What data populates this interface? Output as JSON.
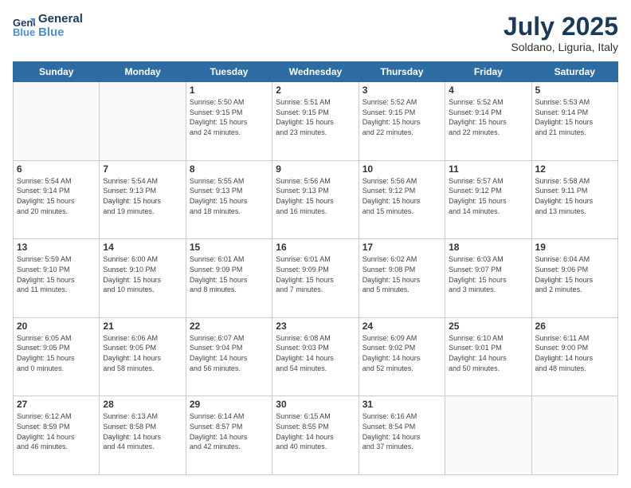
{
  "header": {
    "logo_line1": "General",
    "logo_line2": "Blue",
    "month_title": "July 2025",
    "location": "Soldano, Liguria, Italy"
  },
  "days_of_week": [
    "Sunday",
    "Monday",
    "Tuesday",
    "Wednesday",
    "Thursday",
    "Friday",
    "Saturday"
  ],
  "weeks": [
    [
      {
        "day": "",
        "info": ""
      },
      {
        "day": "",
        "info": ""
      },
      {
        "day": "1",
        "info": "Sunrise: 5:50 AM\nSunset: 9:15 PM\nDaylight: 15 hours\nand 24 minutes."
      },
      {
        "day": "2",
        "info": "Sunrise: 5:51 AM\nSunset: 9:15 PM\nDaylight: 15 hours\nand 23 minutes."
      },
      {
        "day": "3",
        "info": "Sunrise: 5:52 AM\nSunset: 9:15 PM\nDaylight: 15 hours\nand 22 minutes."
      },
      {
        "day": "4",
        "info": "Sunrise: 5:52 AM\nSunset: 9:14 PM\nDaylight: 15 hours\nand 22 minutes."
      },
      {
        "day": "5",
        "info": "Sunrise: 5:53 AM\nSunset: 9:14 PM\nDaylight: 15 hours\nand 21 minutes."
      }
    ],
    [
      {
        "day": "6",
        "info": "Sunrise: 5:54 AM\nSunset: 9:14 PM\nDaylight: 15 hours\nand 20 minutes."
      },
      {
        "day": "7",
        "info": "Sunrise: 5:54 AM\nSunset: 9:13 PM\nDaylight: 15 hours\nand 19 minutes."
      },
      {
        "day": "8",
        "info": "Sunrise: 5:55 AM\nSunset: 9:13 PM\nDaylight: 15 hours\nand 18 minutes."
      },
      {
        "day": "9",
        "info": "Sunrise: 5:56 AM\nSunset: 9:13 PM\nDaylight: 15 hours\nand 16 minutes."
      },
      {
        "day": "10",
        "info": "Sunrise: 5:56 AM\nSunset: 9:12 PM\nDaylight: 15 hours\nand 15 minutes."
      },
      {
        "day": "11",
        "info": "Sunrise: 5:57 AM\nSunset: 9:12 PM\nDaylight: 15 hours\nand 14 minutes."
      },
      {
        "day": "12",
        "info": "Sunrise: 5:58 AM\nSunset: 9:11 PM\nDaylight: 15 hours\nand 13 minutes."
      }
    ],
    [
      {
        "day": "13",
        "info": "Sunrise: 5:59 AM\nSunset: 9:10 PM\nDaylight: 15 hours\nand 11 minutes."
      },
      {
        "day": "14",
        "info": "Sunrise: 6:00 AM\nSunset: 9:10 PM\nDaylight: 15 hours\nand 10 minutes."
      },
      {
        "day": "15",
        "info": "Sunrise: 6:01 AM\nSunset: 9:09 PM\nDaylight: 15 hours\nand 8 minutes."
      },
      {
        "day": "16",
        "info": "Sunrise: 6:01 AM\nSunset: 9:09 PM\nDaylight: 15 hours\nand 7 minutes."
      },
      {
        "day": "17",
        "info": "Sunrise: 6:02 AM\nSunset: 9:08 PM\nDaylight: 15 hours\nand 5 minutes."
      },
      {
        "day": "18",
        "info": "Sunrise: 6:03 AM\nSunset: 9:07 PM\nDaylight: 15 hours\nand 3 minutes."
      },
      {
        "day": "19",
        "info": "Sunrise: 6:04 AM\nSunset: 9:06 PM\nDaylight: 15 hours\nand 2 minutes."
      }
    ],
    [
      {
        "day": "20",
        "info": "Sunrise: 6:05 AM\nSunset: 9:05 PM\nDaylight: 15 hours\nand 0 minutes."
      },
      {
        "day": "21",
        "info": "Sunrise: 6:06 AM\nSunset: 9:05 PM\nDaylight: 14 hours\nand 58 minutes."
      },
      {
        "day": "22",
        "info": "Sunrise: 6:07 AM\nSunset: 9:04 PM\nDaylight: 14 hours\nand 56 minutes."
      },
      {
        "day": "23",
        "info": "Sunrise: 6:08 AM\nSunset: 9:03 PM\nDaylight: 14 hours\nand 54 minutes."
      },
      {
        "day": "24",
        "info": "Sunrise: 6:09 AM\nSunset: 9:02 PM\nDaylight: 14 hours\nand 52 minutes."
      },
      {
        "day": "25",
        "info": "Sunrise: 6:10 AM\nSunset: 9:01 PM\nDaylight: 14 hours\nand 50 minutes."
      },
      {
        "day": "26",
        "info": "Sunrise: 6:11 AM\nSunset: 9:00 PM\nDaylight: 14 hours\nand 48 minutes."
      }
    ],
    [
      {
        "day": "27",
        "info": "Sunrise: 6:12 AM\nSunset: 8:59 PM\nDaylight: 14 hours\nand 46 minutes."
      },
      {
        "day": "28",
        "info": "Sunrise: 6:13 AM\nSunset: 8:58 PM\nDaylight: 14 hours\nand 44 minutes."
      },
      {
        "day": "29",
        "info": "Sunrise: 6:14 AM\nSunset: 8:57 PM\nDaylight: 14 hours\nand 42 minutes."
      },
      {
        "day": "30",
        "info": "Sunrise: 6:15 AM\nSunset: 8:55 PM\nDaylight: 14 hours\nand 40 minutes."
      },
      {
        "day": "31",
        "info": "Sunrise: 6:16 AM\nSunset: 8:54 PM\nDaylight: 14 hours\nand 37 minutes."
      },
      {
        "day": "",
        "info": ""
      },
      {
        "day": "",
        "info": ""
      }
    ]
  ]
}
